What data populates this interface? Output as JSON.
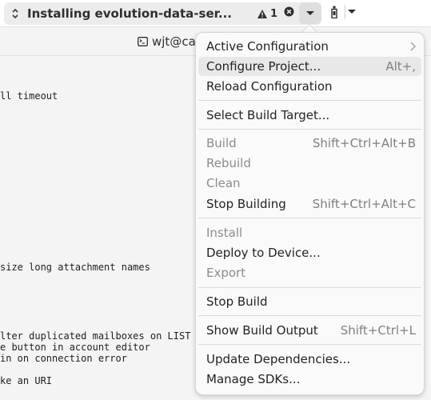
{
  "header": {
    "build_status_title": "Installing evolution-data-ser...",
    "warnings_count": "1",
    "icons": {
      "status_switcher": "up-down-chevron-icon",
      "warning": "warning-triangle-icon",
      "cancel": "cancel-circle-icon",
      "menu": "dropdown-triangle-icon",
      "device": "device-icon"
    }
  },
  "terminal_tab": {
    "title": "wjt@ca"
  },
  "terminal": {
    "lines": [
      {
        "text": "ll timeout"
      },
      {
        "text": "size long attachment names"
      },
      {
        "text": "lter duplicated mailboxes on LIST"
      },
      {
        "text": "e button in account editor"
      },
      {
        "text": "in on connection error"
      },
      {
        "text": "ke an URI"
      }
    ]
  },
  "menu": {
    "items": [
      {
        "label": "Active Configuration",
        "accel": "",
        "submenu": true,
        "disabled": false
      },
      {
        "label": "Configure Project...",
        "accel": "Alt+,",
        "disabled": false,
        "highlighted": true
      },
      {
        "label": "Reload Configuration",
        "accel": "",
        "disabled": false
      },
      {
        "label": "Select Build Target...",
        "accel": "",
        "disabled": false
      },
      {
        "label": "Build",
        "accel": "Shift+Ctrl+Alt+B",
        "disabled": true
      },
      {
        "label": "Rebuild",
        "accel": "",
        "disabled": true
      },
      {
        "label": "Clean",
        "accel": "",
        "disabled": true
      },
      {
        "label": "Stop Building",
        "accel": "Shift+Ctrl+Alt+C",
        "disabled": false
      },
      {
        "label": "Install",
        "accel": "",
        "disabled": true
      },
      {
        "label": "Deploy to Device...",
        "accel": "",
        "disabled": false
      },
      {
        "label": "Export",
        "accel": "",
        "disabled": true
      },
      {
        "label": "Stop Build",
        "accel": "",
        "disabled": false
      },
      {
        "label": "Show Build Output",
        "accel": "Shift+Ctrl+L",
        "disabled": false
      },
      {
        "label": "Update Dependencies...",
        "accel": "",
        "disabled": false
      },
      {
        "label": "Manage SDKs...",
        "accel": "",
        "disabled": false
      }
    ]
  }
}
